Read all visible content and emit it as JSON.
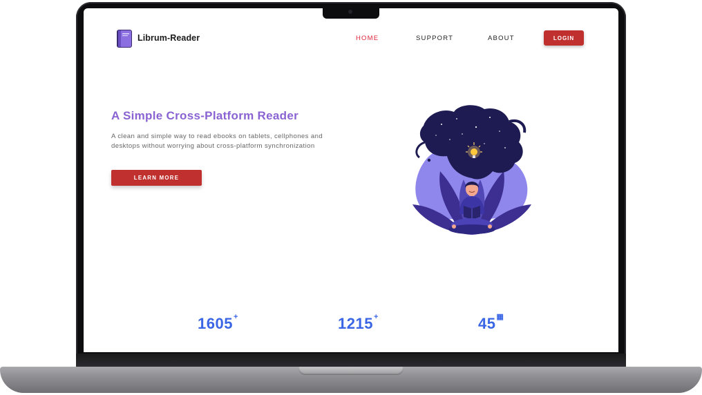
{
  "nav": {
    "brand": "Librum-Reader",
    "links": [
      "HOME",
      "SUPPORT",
      "ABOUT"
    ],
    "login": "LOGIN"
  },
  "hero": {
    "title": "A Simple Cross-Platform Reader",
    "description_line1": "A clean and simple way to read ebooks on tablets, cellphones and",
    "description_line2": "desktops without worrying about cross-platform synchronization",
    "button": "LEARN MORE"
  },
  "stats": [
    {
      "value": "1605",
      "suffix": "+"
    },
    {
      "value": "1215",
      "suffix": "+"
    },
    {
      "value": "45",
      "suffix": "▦"
    }
  ],
  "colors": {
    "accent_red": "#c0302e",
    "active_link": "#e0253b",
    "title_purple": "#8a63d2",
    "stat_blue": "#3a66e6"
  }
}
